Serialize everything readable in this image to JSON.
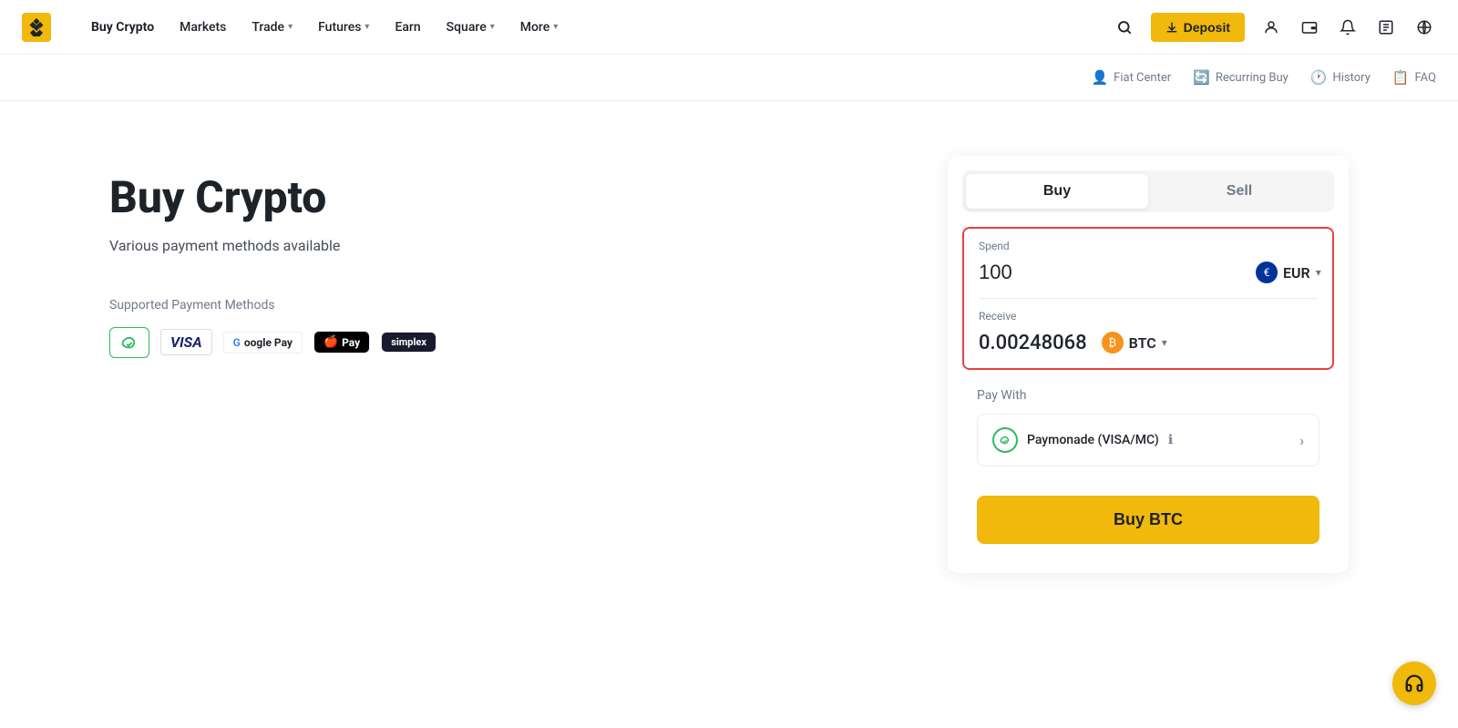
{
  "navbar": {
    "logo_text": "Binance",
    "nav_items": [
      {
        "label": "Buy Crypto",
        "has_dropdown": false,
        "active": true
      },
      {
        "label": "Markets",
        "has_dropdown": false
      },
      {
        "label": "Trade",
        "has_dropdown": true
      },
      {
        "label": "Futures",
        "has_dropdown": true
      },
      {
        "label": "Earn",
        "has_dropdown": false
      },
      {
        "label": "Square",
        "has_dropdown": true
      },
      {
        "label": "More",
        "has_dropdown": true
      }
    ],
    "deposit_btn": "Deposit"
  },
  "sub_nav": {
    "items": [
      {
        "label": "Fiat Center",
        "icon": "👤"
      },
      {
        "label": "Recurring Buy",
        "icon": "🔄"
      },
      {
        "label": "History",
        "icon": "🕐"
      },
      {
        "label": "FAQ",
        "icon": "📋"
      }
    ]
  },
  "hero": {
    "title": "Buy Crypto",
    "subtitle": "Various payment methods available",
    "payment_methods_label": "Supported Payment Methods",
    "payment_methods": [
      {
        "name": "Paymonade",
        "type": "paymonade"
      },
      {
        "name": "VISA",
        "type": "visa"
      },
      {
        "name": "Google Pay",
        "type": "googlepay"
      },
      {
        "name": "Apple Pay",
        "type": "applepay"
      },
      {
        "name": "Simplex",
        "type": "simplex"
      }
    ]
  },
  "trade_card": {
    "buy_tab": "Buy",
    "sell_tab": "Sell",
    "spend_label": "Spend",
    "spend_value": "100",
    "spend_currency": "EUR",
    "receive_label": "Receive",
    "receive_value": "0.00248068",
    "receive_currency": "BTC",
    "pay_with_label": "Pay With",
    "pay_method_name": "Paymonade (VISA/MC)",
    "buy_button": "Buy BTC"
  }
}
